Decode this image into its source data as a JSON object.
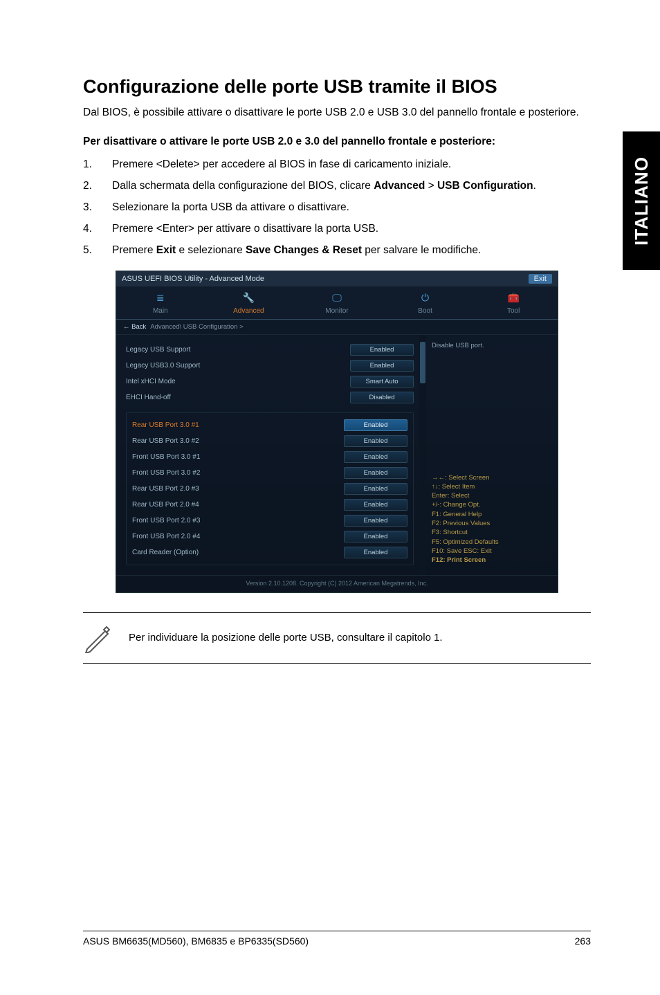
{
  "side_tab": "ITALIANO",
  "title": "Configurazione delle porte USB tramite il BIOS",
  "intro": "Dal BIOS, è possibile attivare o disattivare le porte USB 2.0 e USB 3.0 del pannello frontale e posteriore.",
  "subheading": "Per disattivare o attivare le porte USB 2.0 e 3.0 del pannello frontale e posteriore:",
  "steps": {
    "s1": "Premere <Delete> per accedere al BIOS in fase di caricamento iniziale.",
    "s2a": "Dalla schermata della configurazione del BIOS, clicare ",
    "s2b": "Advanced",
    "s2c": " > ",
    "s2d": "USB Configuration",
    "s2e": ".",
    "s3": "Selezionare la porta USB da attivare o disattivare.",
    "s4": "Premere <Enter> per attivare o disattivare la porta USB.",
    "s5a": "Premere ",
    "s5b": "Exit",
    "s5c": " e selezionare ",
    "s5d": "Save Changes & Reset",
    "s5e": " per salvare le modifiche."
  },
  "bios": {
    "title_left": "ASUS UEFI BIOS Utility - Advanced Mode",
    "title_right": "Exit",
    "tabs": {
      "main": "Main",
      "advanced": "Advanced",
      "monitor": "Monitor",
      "boot": "Boot",
      "tool": "Tool"
    },
    "crumb_back": "← Back",
    "crumb": "Advanced\\ USB Configuration >",
    "opts_top": [
      {
        "label": "Legacy USB Support",
        "value": "Enabled"
      },
      {
        "label": "Legacy USB3.0 Support",
        "value": "Enabled"
      },
      {
        "label": "Intel xHCI Mode",
        "value": "Smart Auto"
      },
      {
        "label": "EHCI Hand-off",
        "value": "Disabled"
      }
    ],
    "opts_group": [
      {
        "label": "Rear USB Port 3.0 #1",
        "value": "Enabled",
        "sel": true
      },
      {
        "label": "Rear USB Port 3.0 #2",
        "value": "Enabled"
      },
      {
        "label": "Front USB Port 3.0 #1",
        "value": "Enabled"
      },
      {
        "label": "Front USB Port 3.0 #2",
        "value": "Enabled"
      },
      {
        "label": "Rear USB Port 2.0 #3",
        "value": "Enabled"
      },
      {
        "label": "Rear USB Port 2.0 #4",
        "value": "Enabled"
      },
      {
        "label": "Front USB Port 2.0 #3",
        "value": "Enabled"
      },
      {
        "label": "Front USB Port 2.0 #4",
        "value": "Enabled"
      },
      {
        "label": "Card Reader (Option)",
        "value": "Enabled"
      }
    ],
    "help_top": "Disable USB port.",
    "help_keys": [
      "→←: Select Screen",
      "↑↓: Select Item",
      "Enter: Select",
      "+/-: Change Opt.",
      "F1: General Help",
      "F2: Previous Values",
      "F3: Shortcut",
      "F5: Optimized Defaults",
      "F10: Save ESC: Exit",
      "F12: Print Screen"
    ],
    "footer": "Version 2.10.1208. Copyright (C) 2012 American Megatrends, Inc."
  },
  "note": "Per individuare la posizione delle porte USB, consultare il capitolo 1.",
  "footer_left": "ASUS BM6635(MD560), BM6835 e BP6335(SD560)",
  "footer_right": "263"
}
